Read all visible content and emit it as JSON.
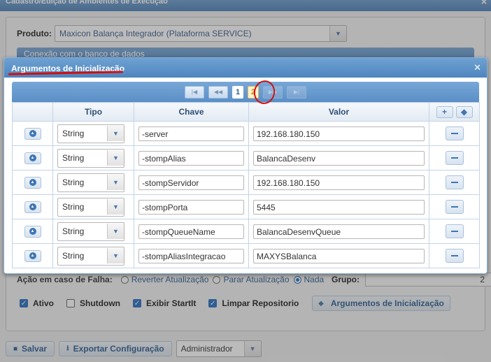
{
  "background": {
    "title": "Cadastro/Edição de Ambientes de Execução",
    "produto_label": "Produto:",
    "produto_value": "Maxicon Balança Integrador (Plataforma SERVICE)",
    "conexao_label": "Conexão com o banco de dados",
    "acao_label": "Ação em caso de Falha:",
    "radios": [
      "Reverter Atualização",
      "Parar Atualização",
      "Nada"
    ],
    "grupo_label": "Grupo:",
    "grupo_value": "2",
    "checks": [
      {
        "label": "Ativo",
        "checked": true
      },
      {
        "label": "Shutdown",
        "checked": false
      },
      {
        "label": "Exibir StartIt",
        "checked": true
      },
      {
        "label": "Limpar Repositorio",
        "checked": true
      }
    ],
    "args_button": "Argumentos de Inicialização",
    "footer": {
      "save": "Salvar",
      "export": "Exportar Configuração",
      "user": "Administrador"
    }
  },
  "modal": {
    "title": "Argumentos de Inicialização",
    "pages": [
      "1",
      "2"
    ],
    "current_page": "2",
    "headers": {
      "tipo": "Tipo",
      "chave": "Chave",
      "valor": "Valor"
    },
    "rows": [
      {
        "tipo": "String",
        "chave": "-server",
        "valor": "192.168.180.150"
      },
      {
        "tipo": "String",
        "chave": "-stompAlias",
        "valor": "BalancaDesenv"
      },
      {
        "tipo": "String",
        "chave": "-stompServidor",
        "valor": "192.168.180.150"
      },
      {
        "tipo": "String",
        "chave": "-stompPorta",
        "valor": "5445"
      },
      {
        "tipo": "String",
        "chave": "-stompQueueName",
        "valor": "BalancaDesenvQueue"
      },
      {
        "tipo": "String",
        "chave": "-stompAliasIntegracao",
        "valor": "MAXYSBalanca"
      }
    ]
  },
  "colors": {
    "accent": "#4e85be",
    "annotation": "#d10f0f",
    "current_page": "#e07a00"
  }
}
